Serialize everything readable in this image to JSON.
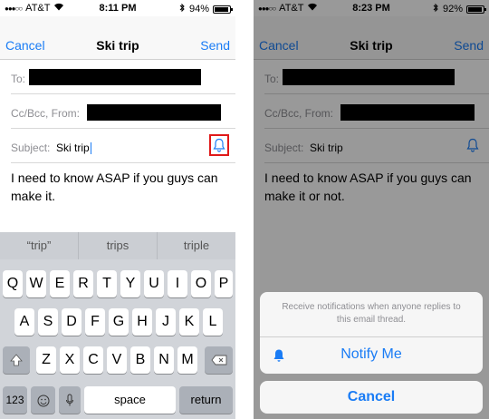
{
  "left": {
    "status": {
      "carrier": "AT&T",
      "time": "8:11 PM",
      "battery": "94%",
      "battery_level": 0.94
    },
    "nav": {
      "cancel": "Cancel",
      "title": "Ski trip",
      "send": "Send"
    },
    "fields": {
      "to": "To:",
      "cc": "Cc/Bcc, From:",
      "subject_label": "Subject:",
      "subject_value": "Ski trip"
    },
    "body": "I need to know ASAP if you guys can make it.",
    "suggestions": [
      "“trip”",
      "trips",
      "triple"
    ],
    "keys": {
      "row1": [
        "Q",
        "W",
        "E",
        "R",
        "T",
        "Y",
        "U",
        "I",
        "O",
        "P"
      ],
      "row2": [
        "A",
        "S",
        "D",
        "F",
        "G",
        "H",
        "J",
        "K",
        "L"
      ],
      "row3": [
        "Z",
        "X",
        "C",
        "V",
        "B",
        "N",
        "M"
      ],
      "num": "123",
      "space": "space",
      "return": "return"
    }
  },
  "right": {
    "status": {
      "carrier": "AT&T",
      "time": "8:23 PM",
      "battery": "92%",
      "battery_level": 0.92
    },
    "nav": {
      "cancel": "Cancel",
      "title": "Ski trip",
      "send": "Send"
    },
    "fields": {
      "to": "To:",
      "cc": "Cc/Bcc, From:",
      "subject_label": "Subject:",
      "subject_value": "Ski trip"
    },
    "body": "I need to know ASAP if you guys can make it or not.",
    "sheet": {
      "message": "Receive notifications when anyone replies to this email thread.",
      "notify": "Notify Me",
      "cancel": "Cancel"
    }
  },
  "colors": {
    "accent": "#1a7cf5",
    "highlight": "#e01a1a"
  }
}
